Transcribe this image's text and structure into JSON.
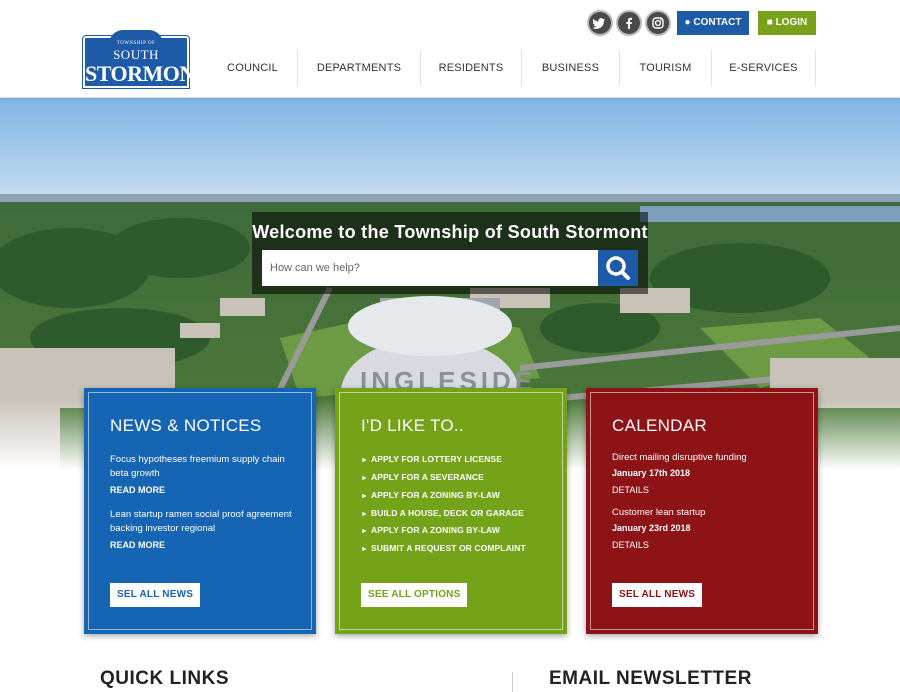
{
  "header": {
    "logo": {
      "small": "TOWNSHIP OF",
      "south": "SOUTH",
      "stormont": "STORMONT"
    },
    "social": [
      {
        "icon": "twitter-icon",
        "glyph": "t"
      },
      {
        "icon": "facebook-icon",
        "glyph": "f"
      },
      {
        "icon": "instagram-icon",
        "glyph": "◎"
      }
    ],
    "contact_label": "CONTACT",
    "login_label": "LOGIN",
    "nav": [
      "COUNCIL",
      "DEPARTMENTS",
      "RESIDENTS",
      "BUSINESS",
      "TOURISM",
      "E-SERVICES"
    ]
  },
  "hero": {
    "title": "Welcome to the Township of South Stormont",
    "search_placeholder": "How can we help?",
    "tower_text": "INGLESIDE"
  },
  "cards": {
    "news": {
      "title": "NEWS & NOTICES",
      "items": [
        {
          "text": "Focus hypotheses freemium supply chain beta growth",
          "link": "READ MORE"
        },
        {
          "text": "Lean startup ramen social proof agreement backing investor regional",
          "link": "READ MORE"
        }
      ],
      "button": "SEL ALL NEWS"
    },
    "options": {
      "title": "I'D LIKE TO..",
      "items": [
        "APPLY FOR LOTTERY LICENSE",
        "APPLY FOR A SEVERANCE",
        "APPLY FOR A ZONING BY-LAW",
        "BUILD A HOUSE, DECK OR GARAGE",
        "APPLY FOR A ZONING BY-LAW",
        "SUBMIT A REQUEST OR COMPLAINT"
      ],
      "button": "SEE ALL OPTIONS"
    },
    "calendar": {
      "title": "CALENDAR",
      "events": [
        {
          "text": "Direct mailing disruptive funding",
          "date": "January 17th 2018",
          "link": "DETAILS"
        },
        {
          "text": "Customer lean startup",
          "date": "January 23rd 2018",
          "link": "DETAILS"
        }
      ],
      "button": "SEL ALL NEWS"
    }
  },
  "sections": {
    "quick_links": "QUICK LINKS",
    "newsletter": "EMAIL NEWSLETTER"
  },
  "colors": {
    "brand_blue": "#1d5ba8",
    "login_green": "#79a21a",
    "card_blue": "#1565b4",
    "card_green": "#74a319",
    "card_red": "#8e1316"
  }
}
